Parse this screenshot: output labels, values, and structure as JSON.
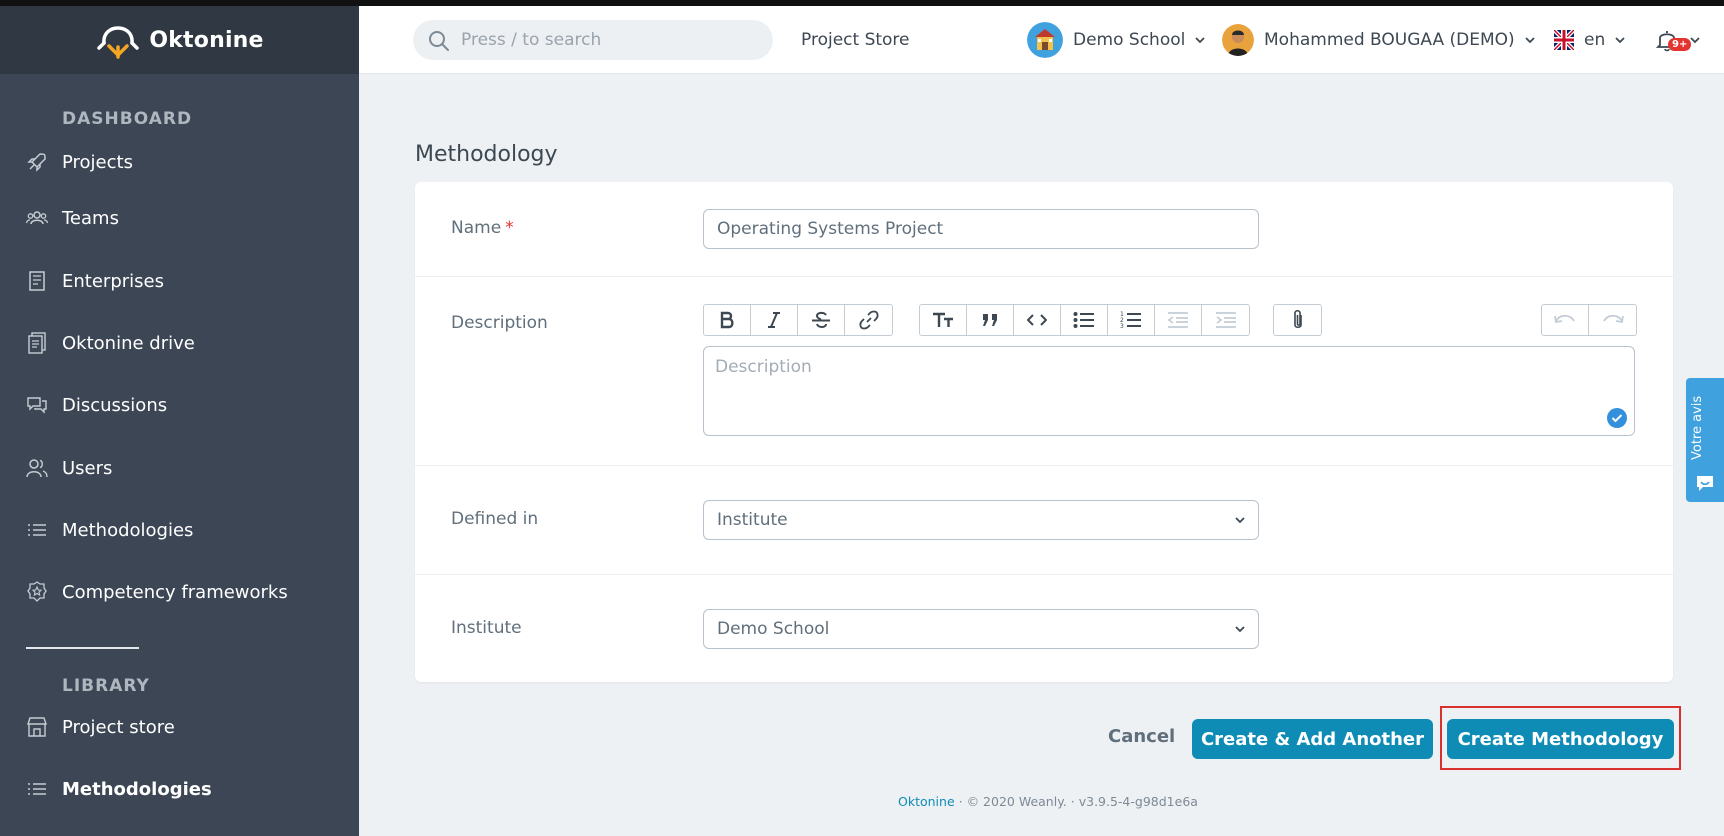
{
  "app": {
    "brand": "Oktonine"
  },
  "sidebar": {
    "section_dashboard": "DASHBOARD",
    "section_library": "LIBRARY",
    "items": [
      {
        "label": "Projects",
        "icon": "rocket-icon"
      },
      {
        "label": "Teams",
        "icon": "team-icon"
      },
      {
        "label": "Enterprises",
        "icon": "building-icon"
      },
      {
        "label": "Oktonine drive",
        "icon": "drive-icon"
      },
      {
        "label": "Discussions",
        "icon": "chat-icon"
      },
      {
        "label": "Users",
        "icon": "users-icon"
      },
      {
        "label": "Methodologies",
        "icon": "list-icon"
      },
      {
        "label": "Competency frameworks",
        "icon": "badge-icon"
      }
    ],
    "library_items": [
      {
        "label": "Project store",
        "icon": "store-icon"
      },
      {
        "label": "Methodologies",
        "icon": "list-icon"
      }
    ]
  },
  "topbar": {
    "search_placeholder": "Press / to search",
    "project_store": "Project Store",
    "school": "Demo School",
    "user": "Mohammed BOUGAA (DEMO)",
    "language": "en",
    "notification_badge": "9+"
  },
  "page": {
    "title": "Methodology"
  },
  "form": {
    "name_label": "Name",
    "name_required_mark": "*",
    "name_value": "Operating Systems Project",
    "description_label": "Description",
    "description_placeholder": "Description",
    "defined_in_label": "Defined in",
    "defined_in_value": "Institute",
    "institute_label": "Institute",
    "institute_value": "Demo School"
  },
  "actions": {
    "cancel": "Cancel",
    "create_add_another": "Create & Add Another",
    "create": "Create Methodology"
  },
  "footer": {
    "brand_link": "Oktonine",
    "sep1": " · ",
    "copyright": "© 2020 Weanly.",
    "sep2": " · ",
    "version": "v3.9.5-4-g98d1e6a"
  },
  "feedback_tab": "Votre avis",
  "colors": {
    "primary": "#0e8cb6",
    "sidebar": "#3c4654",
    "sidebar_header": "#2f3843",
    "highlight": "#d9302e"
  }
}
